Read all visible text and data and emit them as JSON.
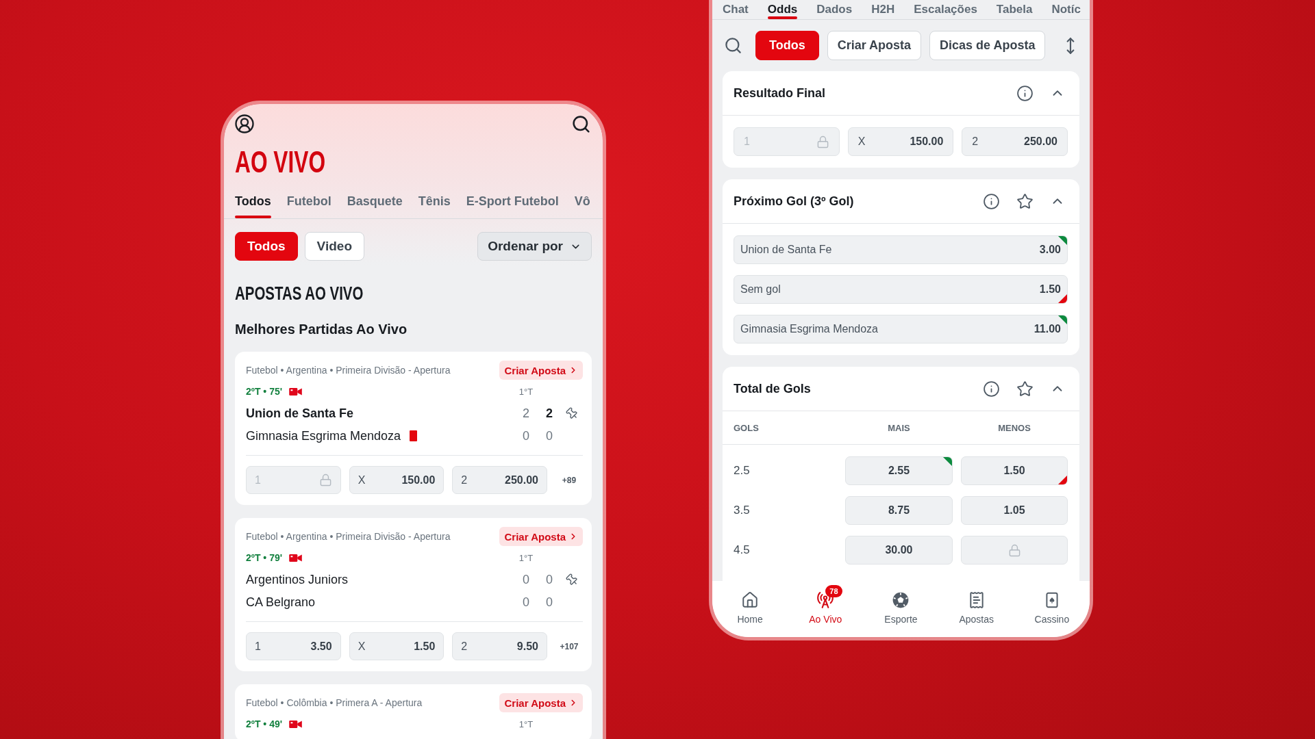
{
  "live_phone": {
    "title": "AO VIVO",
    "sport_tabs": [
      {
        "label": "Todos",
        "selected": true
      },
      {
        "label": "Futebol",
        "selected": false
      },
      {
        "label": "Basquete",
        "selected": false
      },
      {
        "label": "Tênis",
        "selected": false
      },
      {
        "label": "E-Sport Futebol",
        "selected": false
      },
      {
        "label": "Vô",
        "selected": false
      }
    ],
    "filters": [
      {
        "label": "Todos",
        "selected": true
      },
      {
        "label": "Video",
        "selected": false
      }
    ],
    "sort": {
      "label": "Ordenar por"
    },
    "section_title": "APOSTAS AO VIVO",
    "subsection_title": "Melhores Partidas Ao Vivo",
    "matches": [
      {
        "competition": "Futebol • Argentina • Primeira Divisão - Apertura",
        "create_bet": "Criar Aposta",
        "clock": "2ºT • 75'",
        "video": true,
        "period_label": "1°T",
        "teams": [
          {
            "name": "Union de Santa Fe",
            "leading": true,
            "red_card": false,
            "period_score": "2",
            "score": "2"
          },
          {
            "name": "Gimnasia Esgrima Mendoza",
            "leading": false,
            "red_card": true,
            "period_score": "0",
            "score": "0"
          }
        ],
        "odds": [
          {
            "label": "1",
            "locked": true
          },
          {
            "label": "X",
            "value": "150.00",
            "locked": false
          },
          {
            "label": "2",
            "value": "250.00",
            "locked": false
          }
        ],
        "more_markets": "+89"
      },
      {
        "competition": "Futebol • Argentina • Primeira Divisão - Apertura",
        "create_bet": "Criar Aposta",
        "clock": "2ºT • 79'",
        "video": true,
        "period_label": "1°T",
        "teams": [
          {
            "name": "Argentinos Juniors",
            "leading": false,
            "red_card": false,
            "period_score": "0",
            "score": "0"
          },
          {
            "name": "CA Belgrano",
            "leading": false,
            "red_card": false,
            "period_score": "0",
            "score": "0"
          }
        ],
        "odds": [
          {
            "label": "1",
            "value": "3.50",
            "locked": false
          },
          {
            "label": "X",
            "value": "1.50",
            "locked": false
          },
          {
            "label": "2",
            "value": "9.50",
            "locked": false
          }
        ],
        "more_markets": "+107"
      },
      {
        "competition": "Futebol • Colômbia • Primera A - Apertura",
        "create_bet": "Criar Aposta",
        "clock": "2ºT • 49'",
        "video": true,
        "period_label": "1°T"
      }
    ]
  },
  "match_phone": {
    "tabs": [
      {
        "label": "Chat",
        "selected": false
      },
      {
        "label": "Odds",
        "selected": true
      },
      {
        "label": "Dados",
        "selected": false
      },
      {
        "label": "H2H",
        "selected": false
      },
      {
        "label": "Escalações",
        "selected": false
      },
      {
        "label": "Tabela",
        "selected": false
      },
      {
        "label": "Notíc",
        "selected": false
      }
    ],
    "filters": [
      {
        "label": "Todos",
        "selected": true
      },
      {
        "label": "Criar Aposta",
        "selected": false
      },
      {
        "label": "Dicas de Aposta",
        "selected": false
      }
    ],
    "markets": [
      {
        "kind": "three_way",
        "title": "Resultado Final",
        "expanded": true,
        "outcomes": [
          {
            "label": "1",
            "locked": true
          },
          {
            "label": "X",
            "value": "150.00",
            "locked": false
          },
          {
            "label": "2",
            "value": "250.00",
            "locked": false
          }
        ]
      },
      {
        "kind": "list",
        "title": "Próximo Gol (3º Gol)",
        "starred": false,
        "expanded": true,
        "outcomes": [
          {
            "label": "Union de Santa Fe",
            "value": "3.00",
            "rising": true,
            "falling": false
          },
          {
            "label": "Sem gol",
            "value": "1.50",
            "rising": false,
            "falling": true
          },
          {
            "label": "Gimnasia Esgrima Mendoza",
            "value": "11.00",
            "rising": true,
            "falling": false
          }
        ]
      },
      {
        "kind": "over_under",
        "title": "Total de Gols",
        "starred": false,
        "expanded": true,
        "columns": [
          "GOLS",
          "MAIS",
          "MENOS"
        ],
        "rows": [
          {
            "line": "2.5",
            "over": {
              "value": "2.55",
              "rising": true,
              "falling": false,
              "locked": false
            },
            "under": {
              "value": "1.50",
              "rising": false,
              "falling": true,
              "locked": false
            }
          },
          {
            "line": "3.5",
            "over": {
              "value": "8.75",
              "rising": false,
              "falling": false,
              "locked": false
            },
            "under": {
              "value": "1.05",
              "rising": false,
              "falling": false,
              "locked": false
            }
          },
          {
            "line": "4.5",
            "over": {
              "value": "30.00",
              "rising": false,
              "falling": false,
              "locked": false
            },
            "under": {
              "rising": false,
              "falling": false,
              "locked": true
            }
          }
        ]
      }
    ],
    "bottom_nav": [
      {
        "label": "Home",
        "selected": false
      },
      {
        "label": "Ao Vivo",
        "selected": true,
        "badge": "78"
      },
      {
        "label": "Esporte",
        "selected": false
      },
      {
        "label": "Apostas",
        "selected": false
      },
      {
        "label": "Cassino",
        "selected": false
      }
    ]
  }
}
